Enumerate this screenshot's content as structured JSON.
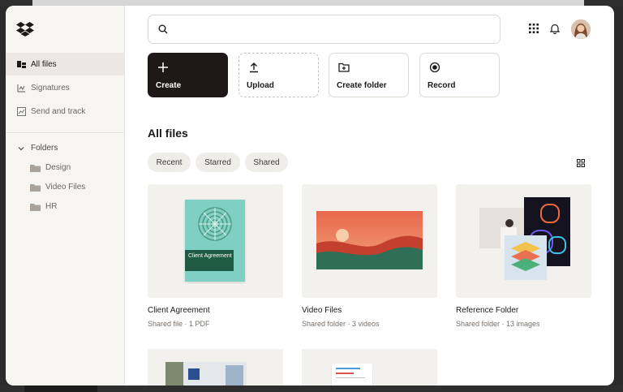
{
  "sidebar": {
    "items": [
      {
        "label": "All files",
        "icon": "files-icon",
        "active": true
      },
      {
        "label": "Signatures",
        "icon": "signature-icon",
        "active": false
      },
      {
        "label": "Send and track",
        "icon": "chart-icon",
        "active": false
      }
    ],
    "folders_label": "Folders",
    "folders": [
      {
        "label": "Design"
      },
      {
        "label": "Video Files"
      },
      {
        "label": "HR"
      }
    ]
  },
  "search": {
    "placeholder": ""
  },
  "actions": [
    {
      "label": "Create",
      "icon": "plus-icon"
    },
    {
      "label": "Upload",
      "icon": "upload-icon"
    },
    {
      "label": "Create folder",
      "icon": "folder-plus-icon"
    },
    {
      "label": "Record",
      "icon": "record-icon"
    }
  ],
  "main": {
    "title": "All files",
    "filters": [
      "Recent",
      "Starred",
      "Shared"
    ],
    "cards": [
      {
        "title": "Client Agreement",
        "subtitle": "Shared file · 1 PDF",
        "cover_text": "Client Agreement"
      },
      {
        "title": "Video Files",
        "subtitle": "Shared folder · 3 videos"
      },
      {
        "title": "Reference Folder",
        "subtitle": "Shared folder · 13 images"
      }
    ]
  },
  "colors": {
    "accent_dark": "#1e1919",
    "sidebar_bg": "#f7f5f2",
    "card_bg": "#f3f1ee",
    "cover_green": "#7fcfc2",
    "label_green": "#1f5a45"
  }
}
